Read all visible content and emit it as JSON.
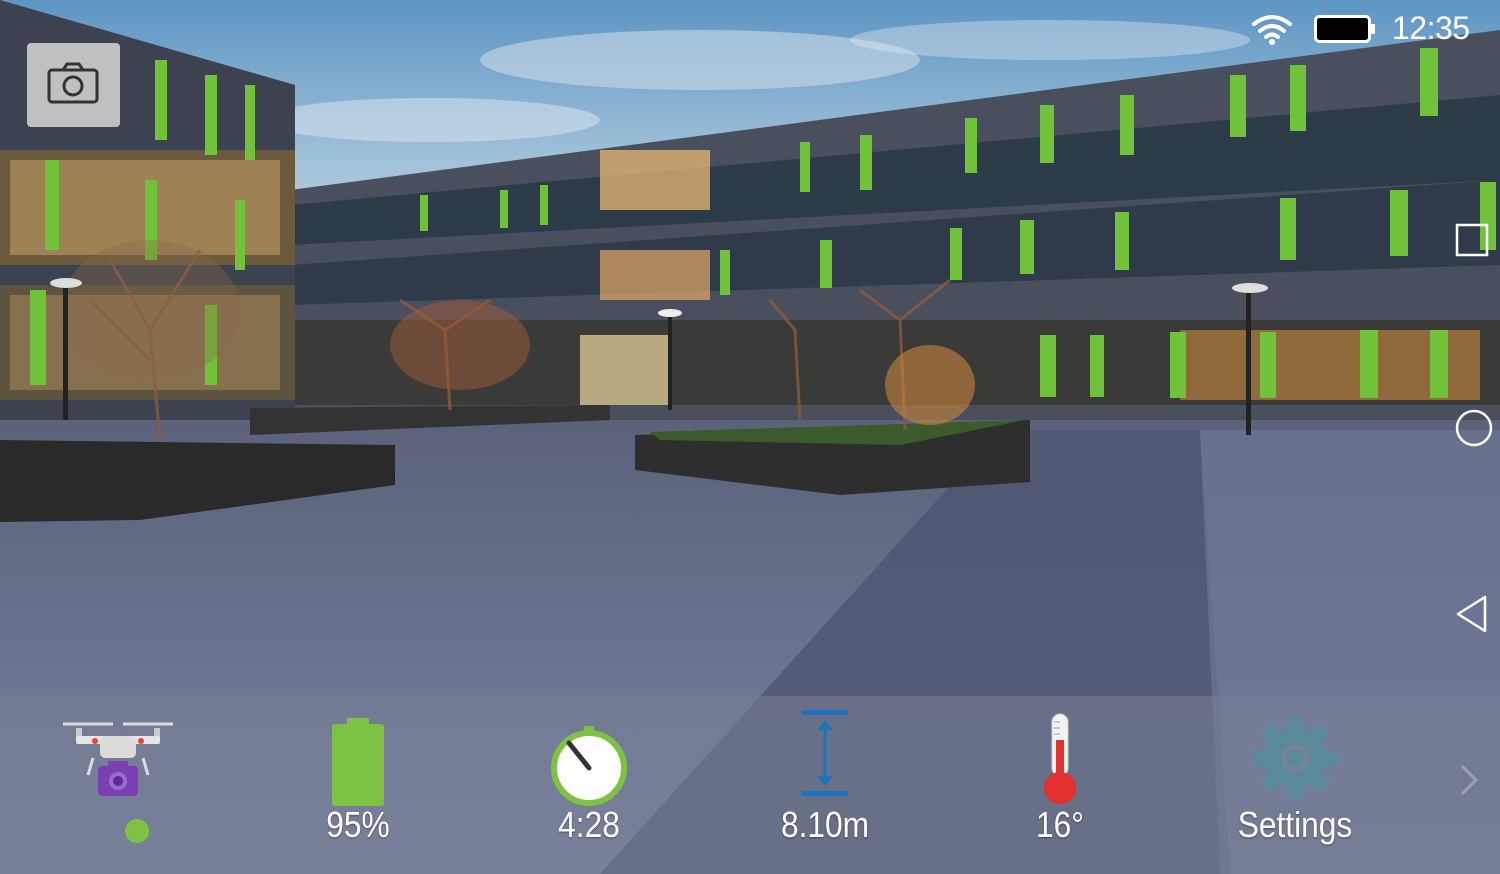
{
  "status_bar": {
    "time": "12:35",
    "wifi_icon": "wifi-icon",
    "battery_icon": "battery-icon"
  },
  "camera_button": {
    "icon": "camera-icon"
  },
  "nav_buttons": [
    {
      "name": "recent-apps",
      "icon": "square-icon"
    },
    {
      "name": "home",
      "icon": "circle-icon"
    },
    {
      "name": "back",
      "icon": "triangle-back-icon"
    },
    {
      "name": "expand",
      "icon": "chevron-right-icon"
    }
  ],
  "hud": {
    "drone": {
      "icon": "drone-camera-icon",
      "connection_color": "#7dc242"
    },
    "battery": {
      "label": "95%",
      "icon": "battery-level-icon",
      "level": 0.95,
      "color": "#7dc242"
    },
    "flight_time": {
      "label": "4:28",
      "icon": "stopwatch-icon"
    },
    "altitude": {
      "label": "8.10m",
      "icon": "altitude-icon"
    },
    "temperature": {
      "label": "16°",
      "icon": "thermometer-icon"
    },
    "settings": {
      "label": "Settings",
      "icon": "gear-icon"
    }
  }
}
